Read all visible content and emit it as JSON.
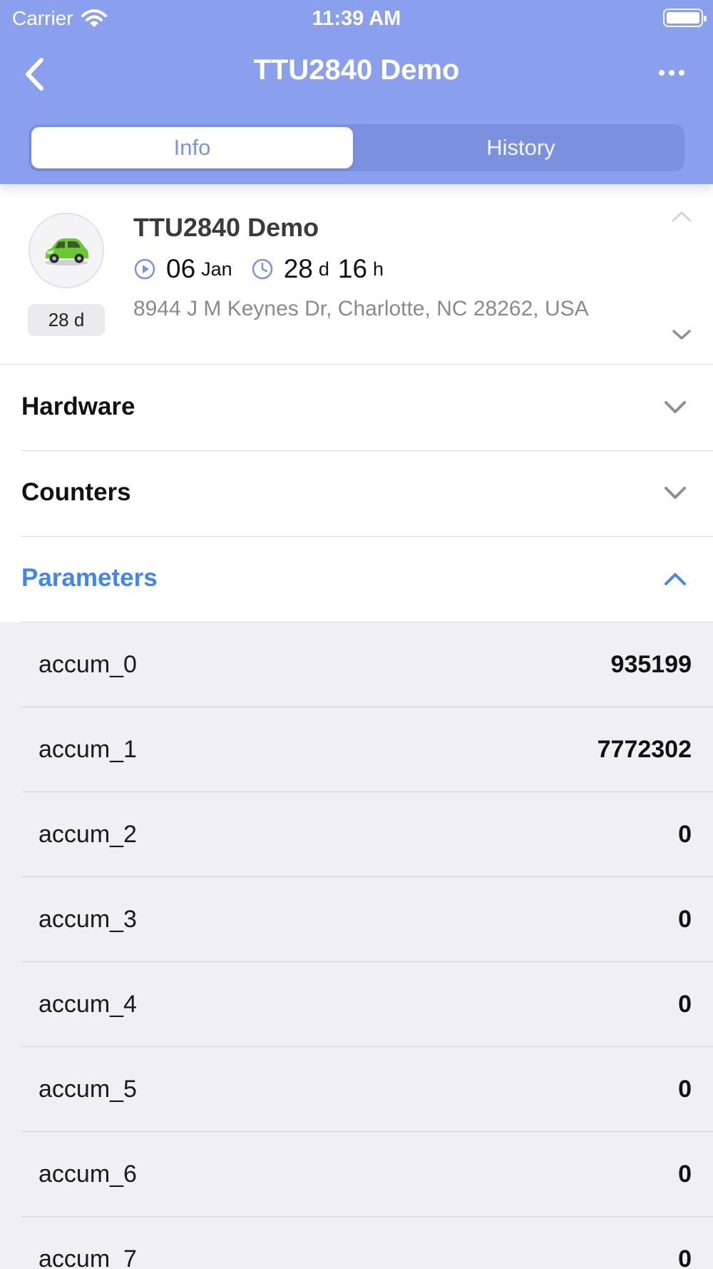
{
  "status_bar": {
    "carrier": "Carrier",
    "time": "11:39 AM"
  },
  "nav": {
    "title": "TTU2840 Demo"
  },
  "tabs": [
    {
      "label": "Info",
      "selected": true
    },
    {
      "label": "History",
      "selected": false
    }
  ],
  "unit": {
    "name": "TTU2840 Demo",
    "age_badge": "28 d",
    "date_day": "06",
    "date_month": "Jan",
    "duration_days": "28",
    "duration_days_unit": "d",
    "duration_hours": "16",
    "duration_hours_unit": "h",
    "address": "8944 J M Keynes Dr, Charlotte, NC 28262, USA"
  },
  "sections": {
    "hardware": "Hardware",
    "counters": "Counters",
    "parameters": "Parameters"
  },
  "parameters": [
    {
      "name": "accum_0",
      "value": "935199"
    },
    {
      "name": "accum_1",
      "value": "7772302"
    },
    {
      "name": "accum_2",
      "value": "0"
    },
    {
      "name": "accum_3",
      "value": "0"
    },
    {
      "name": "accum_4",
      "value": "0"
    },
    {
      "name": "accum_5",
      "value": "0"
    },
    {
      "name": "accum_6",
      "value": "0"
    },
    {
      "name": "accum_7",
      "value": "0"
    }
  ],
  "colors": {
    "header": "#8aa0ee",
    "accent": "#3f86ee",
    "segment_selected_text": "#7b91ea",
    "list_background": "#efeff4"
  }
}
